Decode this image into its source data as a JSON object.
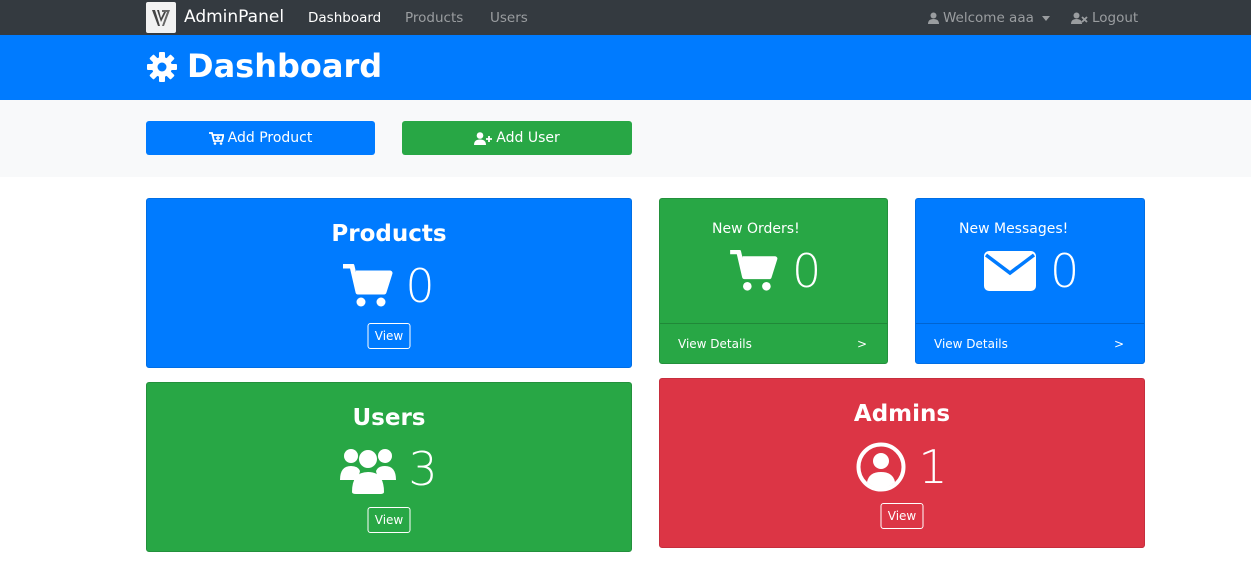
{
  "navbar": {
    "brand": "AdminPanel",
    "links": [
      "Dashboard",
      "Products",
      "Users"
    ],
    "active": "Dashboard",
    "user_menu": "Welcome aaa",
    "logout": "Logout"
  },
  "header": {
    "title": "Dashboard",
    "icon": "gear-icon"
  },
  "actions": {
    "add_product": "Add Product",
    "add_user": "Add User"
  },
  "cards": {
    "products": {
      "title": "Products",
      "count": "0",
      "button": "View",
      "icon": "cart-icon",
      "color": "#007bff"
    },
    "new_orders": {
      "title": "New Orders!",
      "count": "0",
      "footer": "View Details",
      "arrow": ">",
      "icon": "cart-icon",
      "color": "#28a745"
    },
    "new_messages": {
      "title": "New Messages!",
      "count": "0",
      "footer": "View Details",
      "arrow": ">",
      "icon": "envelope-icon",
      "color": "#007bff"
    },
    "users": {
      "title": "Users",
      "count": "3",
      "button": "View",
      "icon": "users-icon",
      "color": "#28a745"
    },
    "admins": {
      "title": "Admins",
      "count": "1",
      "button": "View",
      "icon": "user-circle-icon",
      "color": "#dc3545"
    }
  }
}
